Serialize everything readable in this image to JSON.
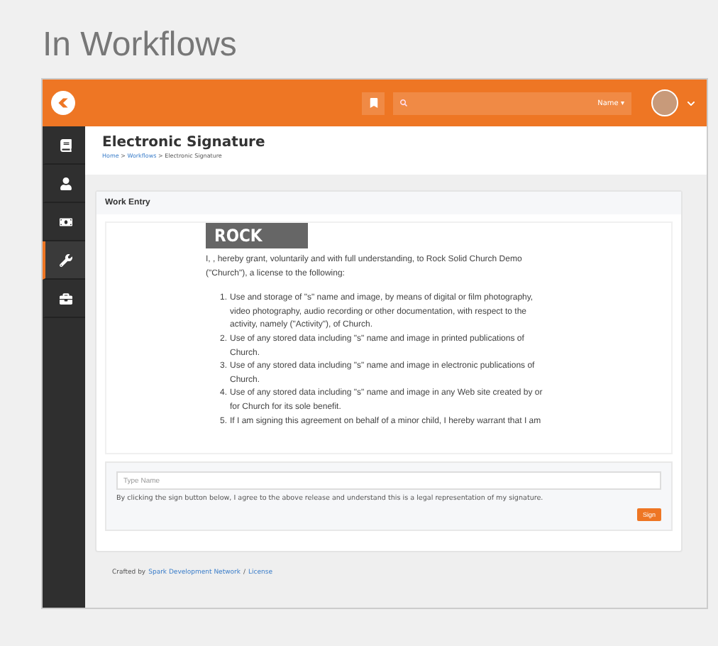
{
  "page_title": "In Workflows",
  "topbar": {
    "search": {
      "scope": "Name",
      "caret": "▾"
    }
  },
  "sidebar": {
    "items": [
      {
        "selected": false
      },
      {
        "selected": false
      },
      {
        "selected": false
      },
      {
        "selected": true
      },
      {
        "selected": false
      }
    ]
  },
  "header": {
    "title": "Electronic Signature",
    "breadcrumbs": [
      "Home",
      "Workflows",
      "Electronic Signature"
    ],
    "separator": ">"
  },
  "panel": {
    "title": "Work Entry",
    "document": {
      "logo": "ROCK",
      "intro": "I, , hereby grant, voluntarily and with full understanding, to Rock Solid Church Demo (\"Church\"), a license to the following:",
      "items": [
        {
          "number": "1.",
          "text": "Use and storage of \"s\" name and image, by means of digital or film photography, video photography, audio recording or other documentation, with respect to the activity, namely (\"Activity\"), of Church."
        },
        {
          "number": "2.",
          "text": "Use of any stored data including \"s\" name and image in printed publications of Church."
        },
        {
          "number": "3.",
          "text": "Use of any stored data including \"s\" name and image in electronic publications of Church."
        },
        {
          "number": "4.",
          "text": "Use of any stored data including \"s\" name and image in any Web site created by or for Church for its sole benefit."
        },
        {
          "number": "5.",
          "text": "If I am signing this agreement on behalf of a minor child, I hereby warrant that I am"
        }
      ]
    },
    "signature": {
      "placeholder": "Type Name",
      "notice": "By clicking the sign button below, I agree to the above release and understand this is a legal representation of my signature.",
      "button": "Sign"
    }
  },
  "footer": {
    "prefix": "Crafted by",
    "link": "Spark Development Network",
    "separator": "/",
    "license": "License"
  }
}
